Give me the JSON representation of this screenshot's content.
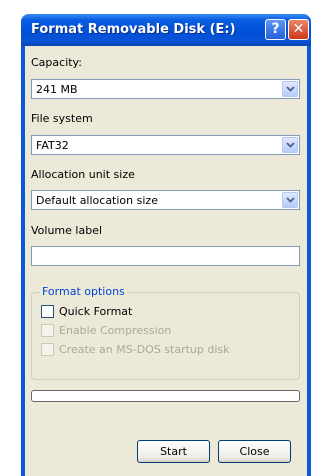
{
  "window": {
    "title": "Format Removable Disk (E:)",
    "help_button": "?",
    "close_button": "✕"
  },
  "capacity": {
    "label": "Capacity:",
    "value": "241 MB"
  },
  "file_system": {
    "label": "File system",
    "value": "FAT32"
  },
  "allocation": {
    "label": "Allocation unit size",
    "value": "Default allocation size"
  },
  "volume_label": {
    "label": "Volume label",
    "value": ""
  },
  "format_options": {
    "title": "Format options",
    "quick_format": {
      "label": "Quick Format",
      "checked": false,
      "enabled": true
    },
    "enable_compression": {
      "label": "Enable Compression",
      "checked": false,
      "enabled": false
    },
    "msdos_startup": {
      "label": "Create an MS-DOS startup disk",
      "checked": false,
      "enabled": false
    }
  },
  "progress": {
    "fraction": 0
  },
  "buttons": {
    "start": "Start",
    "close": "Close"
  },
  "colors": {
    "titlebar": "#0050d8",
    "dialog_bg": "#ece9d8",
    "group_title": "#0046d5"
  }
}
